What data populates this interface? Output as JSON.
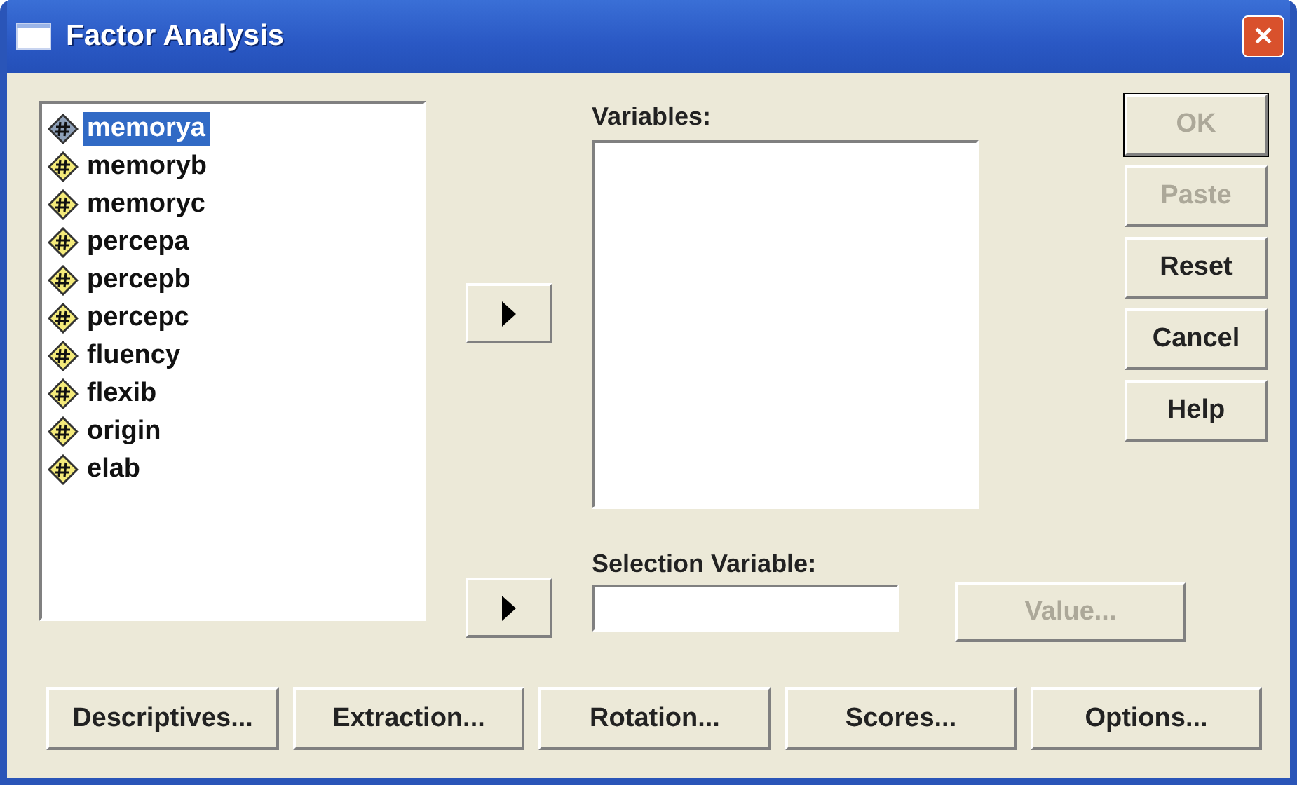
{
  "window": {
    "title": "Factor Analysis",
    "close_label": "✕"
  },
  "source_list": {
    "items": [
      {
        "label": "memorya",
        "selected": true
      },
      {
        "label": "memoryb",
        "selected": false
      },
      {
        "label": "memoryc",
        "selected": false
      },
      {
        "label": "percepa",
        "selected": false
      },
      {
        "label": "percepb",
        "selected": false
      },
      {
        "label": "percepc",
        "selected": false
      },
      {
        "label": "fluency",
        "selected": false
      },
      {
        "label": "flexib",
        "selected": false
      },
      {
        "label": "origin",
        "selected": false
      },
      {
        "label": "elab",
        "selected": false
      }
    ]
  },
  "variables": {
    "label": "Variables:"
  },
  "selection_variable": {
    "label": "Selection Variable:",
    "value_button": {
      "label": "Value...",
      "disabled": true
    }
  },
  "side_buttons": [
    {
      "label": "OK",
      "disabled": true,
      "default": true
    },
    {
      "label": "Paste",
      "disabled": true,
      "default": false
    },
    {
      "label": "Reset",
      "disabled": false,
      "default": false
    },
    {
      "label": "Cancel",
      "disabled": false,
      "default": false
    },
    {
      "label": "Help",
      "disabled": false,
      "default": false
    }
  ],
  "bottom_buttons": [
    "Descriptives...",
    "Extraction...",
    "Rotation...",
    "Scores...",
    "Options..."
  ]
}
